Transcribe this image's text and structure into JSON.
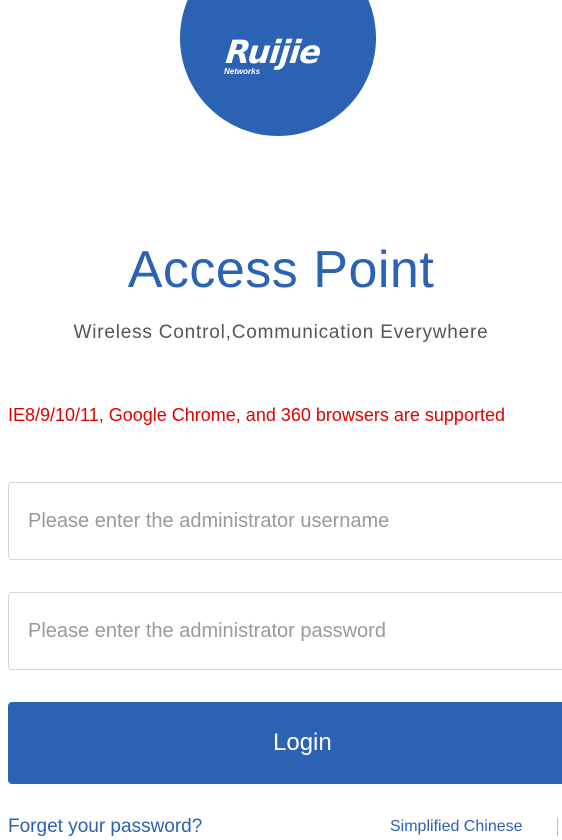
{
  "brand": {
    "logo_text": "Ruijie",
    "logo_subtext": "Networks",
    "color": "#2b62b3"
  },
  "header": {
    "title": "Access Point",
    "subtitle": "Wireless Control,Communication Everywhere"
  },
  "notice": {
    "text": "IE8/9/10/11, Google Chrome, and 360 browsers are supported",
    "color": "#e00000"
  },
  "form": {
    "username": {
      "placeholder": "Please enter the administrator username",
      "value": ""
    },
    "password": {
      "placeholder": "Please enter the administrator password",
      "value": ""
    },
    "login_label": "Login"
  },
  "footer": {
    "forgot_label": "Forget your password?",
    "language_label": "Simplified Chinese"
  }
}
